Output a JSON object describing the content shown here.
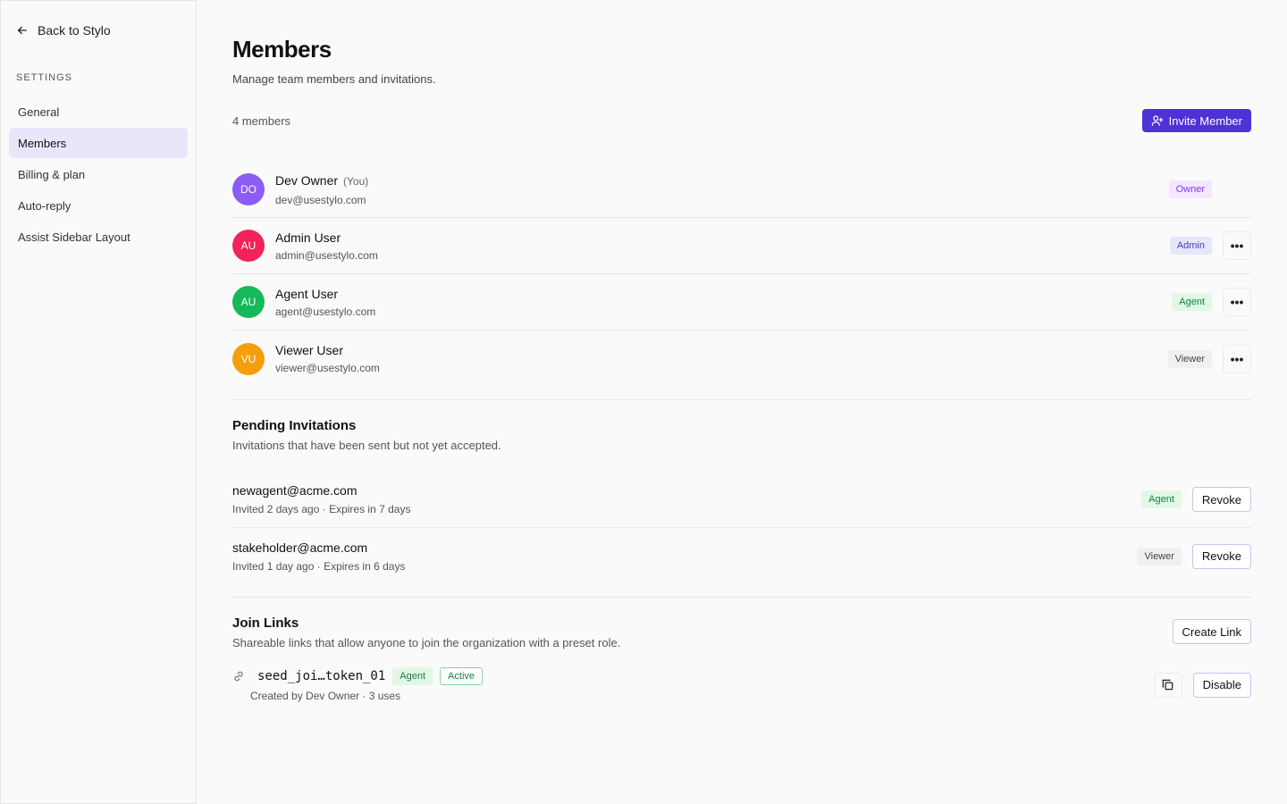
{
  "sidebar": {
    "back_label": "Back to Stylo",
    "section_label": "SETTINGS",
    "items": [
      {
        "label": "General"
      },
      {
        "label": "Members"
      },
      {
        "label": "Billing & plan"
      },
      {
        "label": "Auto-reply"
      },
      {
        "label": "Assist Sidebar Layout"
      }
    ]
  },
  "header": {
    "title": "Members",
    "subtitle": "Manage team members and invitations."
  },
  "members": {
    "count_label": "4 members",
    "invite_button": "Invite Member",
    "list": [
      {
        "initials": "DO",
        "name": "Dev Owner",
        "you": "(You)",
        "email": "dev@usestylo.com",
        "role": "Owner",
        "color": "#8b5cf6"
      },
      {
        "initials": "AU",
        "name": "Admin User",
        "email": "admin@usestylo.com",
        "role": "Admin",
        "color": "#f0245a"
      },
      {
        "initials": "AU",
        "name": "Agent User",
        "email": "agent@usestylo.com",
        "role": "Agent",
        "color": "#16b85a"
      },
      {
        "initials": "VU",
        "name": "Viewer User",
        "email": "viewer@usestylo.com",
        "role": "Viewer",
        "color": "#f59e0b"
      }
    ]
  },
  "pending": {
    "title": "Pending Invitations",
    "description": "Invitations that have been sent but not yet accepted.",
    "revoke_label": "Revoke",
    "list": [
      {
        "email": "newagent@acme.com",
        "meta": "Invited 2 days ago · Expires in 7 days",
        "role": "Agent"
      },
      {
        "email": "stakeholder@acme.com",
        "meta": "Invited 1 day ago · Expires in 6 days",
        "role": "Viewer"
      }
    ]
  },
  "join_links": {
    "title": "Join Links",
    "description": "Shareable links that allow anyone to join the organization with a preset role.",
    "create_label": "Create Link",
    "disable_label": "Disable",
    "link": {
      "token": "seed_joi…token_01",
      "role": "Agent",
      "status": "Active",
      "meta": "Created by Dev Owner · 3 uses"
    }
  }
}
